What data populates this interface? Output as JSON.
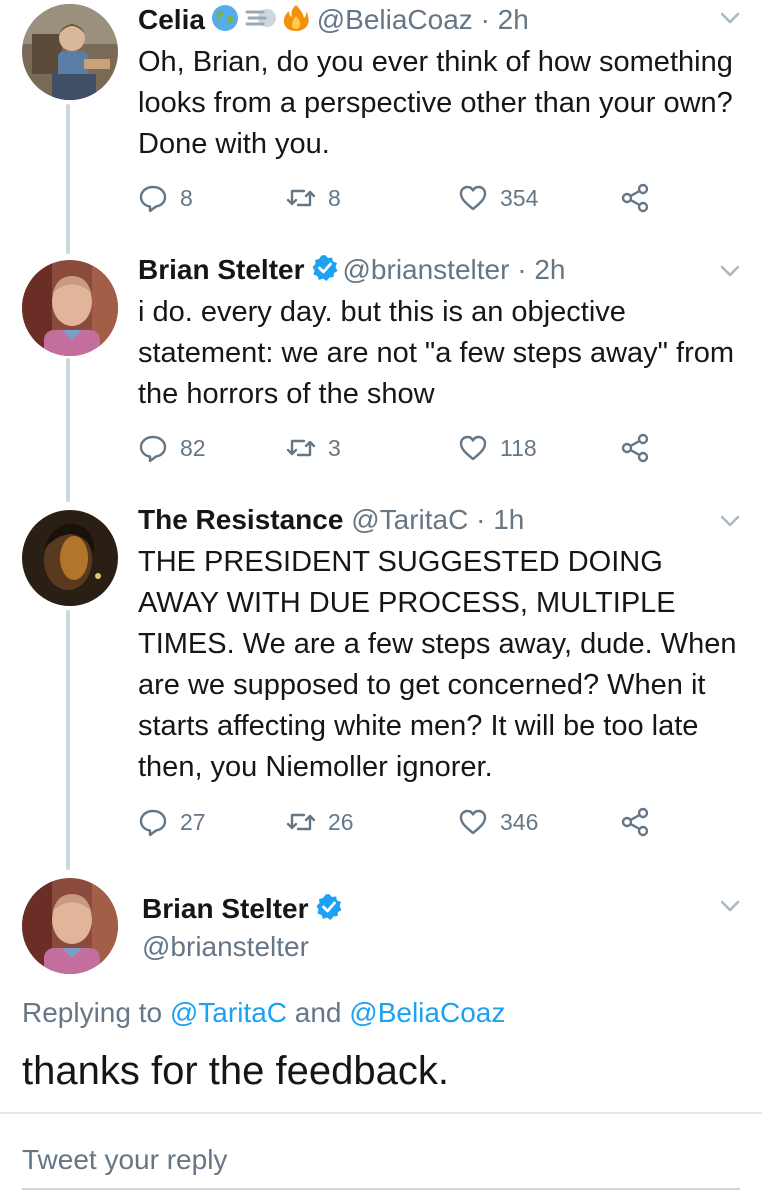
{
  "tweets": [
    {
      "name": "Celia",
      "handle": "@BeliaCoaz",
      "separator": "·",
      "time": "2h",
      "text": "Oh, Brian, do you ever think of how something looks from a perspective other than your own? Done with you.",
      "replies": "8",
      "retweets": "8",
      "likes": "354",
      "emoji_icons": [
        "earth-globe-icon",
        "dash-icon",
        "fire-icon"
      ]
    },
    {
      "name": "Brian Stelter",
      "handle": "@brianstelter",
      "separator": "·",
      "time": "2h",
      "text": "i do. every day. but this is an objective statement: we are not \"a few steps away\" from the horrors of the show",
      "replies": "82",
      "retweets": "3",
      "likes": "118"
    },
    {
      "name": "The Resistance",
      "handle": "@TaritaC",
      "separator": "·",
      "time": "1h",
      "text": "THE PRESIDENT SUGGESTED DOING AWAY WITH DUE PROCESS, MULTIPLE TIMES. We are a few steps away, dude. When are we supposed to get concerned? When it starts affecting white men? It will be too late then, you Niemoller ignorer.",
      "replies": "27",
      "retweets": "26",
      "likes": "346"
    }
  ],
  "main_tweet": {
    "name": "Brian Stelter",
    "handle": "@brianstelter",
    "replying_prefix": "Replying to",
    "replying_mention_1": "@TaritaC",
    "replying_conjunction": "and",
    "replying_mention_2": "@BeliaCoaz",
    "text": "thanks for the feedback."
  },
  "reply_box": {
    "placeholder": "Tweet your reply"
  },
  "colors": {
    "accent": "#1da1f2",
    "secondary_text": "#657786",
    "thread_line": "#ccd6dd",
    "verified": "#1da1f2"
  }
}
